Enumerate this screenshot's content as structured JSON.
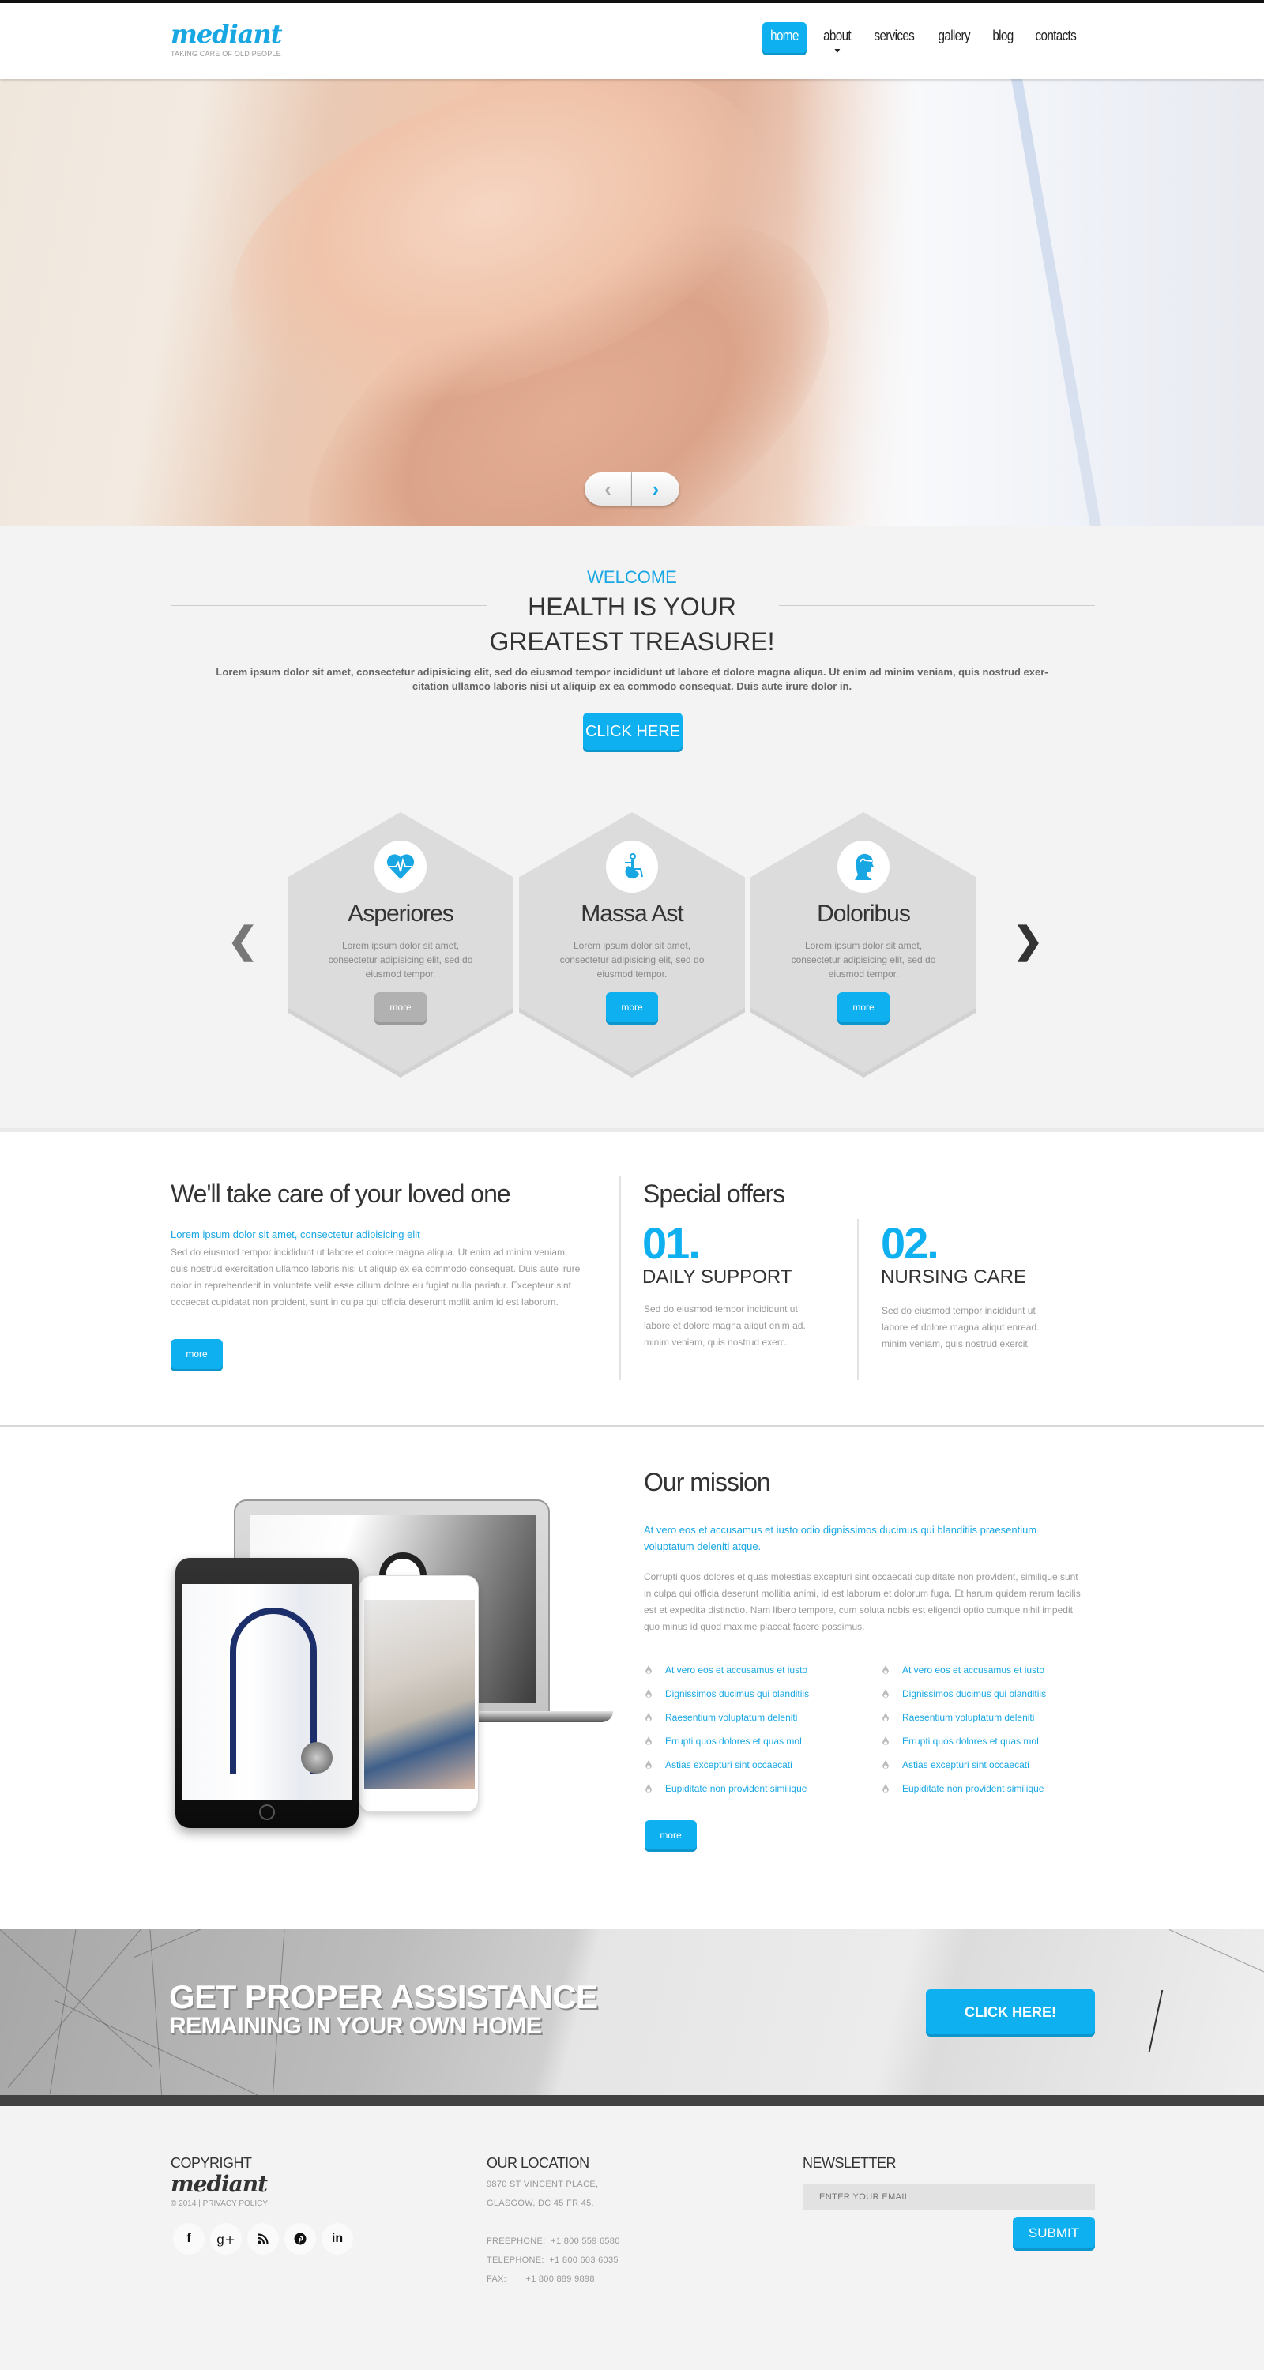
{
  "header": {
    "logo": "mediant",
    "tagline": "TAKING CARE OF OLD PEOPLE",
    "nav": [
      {
        "label": "home",
        "active": true
      },
      {
        "label": "about",
        "has_dropdown": true
      },
      {
        "label": "services"
      },
      {
        "label": "gallery"
      },
      {
        "label": "blog"
      },
      {
        "label": "contacts"
      }
    ]
  },
  "hero": {
    "image": "hands-holding-image",
    "prev_icon": "‹",
    "next_icon": "›"
  },
  "welcome": {
    "label": "WELCOME",
    "title": "HEALTH IS YOUR GREATEST TREASURE!",
    "text": "Lorem ipsum dolor sit amet, consectetur adipisicing elit, sed do eiusmod tempor incididunt ut labore et dolore magna aliqua. Ut enim ad minim veniam, quis nostrud exer- citation ullamco laboris nisi ut aliquip ex ea commodo consequat. Duis aute irure dolor in.",
    "button": "CLICK HERE",
    "carousel_prev": "❮",
    "carousel_next": "❯",
    "services": [
      {
        "icon": "heart-pulse-icon",
        "title": "Asperiores",
        "text": "Lorem ipsum dolor sit amet, consectetur adipisicing elit, sed do eiusmod tempor.",
        "button": "more",
        "button_state": "inactive"
      },
      {
        "icon": "wheelchair-icon",
        "title": "Massa Ast",
        "text": "Lorem ipsum dolor sit amet, consectetur adipisicing elit, sed do eiusmod tempor.",
        "button": "more",
        "button_state": "active"
      },
      {
        "icon": "head-profile-icon",
        "title": "Doloribus",
        "text": "Lorem ipsum dolor sit amet, consectetur adipisicing elit, sed do eiusmod tempor.",
        "button": "more",
        "button_state": "active"
      }
    ]
  },
  "care": {
    "title": "We'll take care of your loved one",
    "subtitle": "Lorem ipsum dolor sit amet, consectetur adipisicing elit",
    "text": "Sed do eiusmod tempor incididunt ut labore et dolore magna aliqua. Ut enim ad minim veniam, quis nostrud exercitation ullamco laboris nisi ut aliquip ex ea commodo consequat. Duis aute irure dolor in reprehenderit in voluptate velit esse cillum dolore eu fugiat nulla pariatur. Excepteur sint occaecat cupidatat non proident, sunt in culpa qui officia deserunt mollit anim id est laborum.",
    "button": "more"
  },
  "offers": {
    "title": "Special offers",
    "items": [
      {
        "number": "01.",
        "heading": "DAILY SUPPORT",
        "text": "Sed do eiusmod tempor incididunt ut labore et dolore magna aliqut enim ad. minim veniam, quis nostrud exerc."
      },
      {
        "number": "02.",
        "heading": "NURSING CARE",
        "text": "Sed do eiusmod tempor incididunt ut labore et dolore magna aliqut enread. minim veniam, quis nostrud exercit."
      }
    ]
  },
  "mission": {
    "title": "Our mission",
    "subtitle": "At vero eos et accusamus et iusto odio dignissimos ducimus qui blanditiis praesentium voluptatum deleniti atque.",
    "text": "Corrupti quos dolores et quas molestias excepturi sint occaecati cupiditate non provident, similique sunt in culpa qui officia deserunt mollitia animi, id est laborum et dolorum fuga. Et harum quidem rerum facilis est et expedita distinctio. Nam libero tempore, cum soluta nobis est eligendi optio cumque nihil impedit quo minus id quod maxime placeat facere possimus.",
    "list_left": [
      "At vero eos et accusamus et iusto",
      "Dignissimos ducimus qui blanditiis",
      "Raesentium voluptatum deleniti",
      "Errupti quos dolores et quas mol",
      "Astias excepturi sint occaecati",
      "Eupiditate non provident similique"
    ],
    "list_right": [
      "At vero eos et accusamus et iusto",
      "Dignissimos ducimus qui blanditiis",
      "Raesentium voluptatum deleniti",
      "Errupti quos dolores et quas mol",
      "Astias excepturi sint occaecati",
      "Eupiditate non provident similique"
    ],
    "button": "more",
    "image": "devices-medical-image"
  },
  "cta": {
    "title": "GET PROPER ASSISTANCE",
    "subtitle": "REMAINING IN YOUR OWN HOME",
    "button": "CLICK HERE!"
  },
  "footer": {
    "copyright": {
      "heading": "COPYRIGHT",
      "logo": "mediant",
      "copy": "© 2014",
      "separator": "|",
      "privacy": "PRIVACY POLICY",
      "social": [
        {
          "name": "facebook",
          "glyph": "f"
        },
        {
          "name": "google-plus",
          "glyph": "g+"
        },
        {
          "name": "rss",
          "glyph": "◝"
        },
        {
          "name": "pinterest",
          "glyph": "℗"
        },
        {
          "name": "linkedin",
          "glyph": "in"
        }
      ]
    },
    "location": {
      "heading": "OUR LOCATION",
      "address_line1": "9870 ST VINCENT PLACE,",
      "address_line2": "GLASGOW, DC 45 FR 45.",
      "freephone_label": "FREEPHONE:",
      "freephone": "+1 800 559 6580",
      "telephone_label": "TELEPHONE:",
      "telephone": "+1 800 603 6035",
      "fax_label": "FAX:",
      "fax": "+1 800 889 9898"
    },
    "newsletter": {
      "heading": "NEWSLETTER",
      "placeholder": "ENTER YOUR EMAIL",
      "button": "SUBMIT"
    }
  },
  "colors": {
    "accent": "#0fb0f0",
    "accent_dark": "#0d96cc",
    "text_dark": "#333333",
    "text_muted": "#999999",
    "footer_bar": "#424242"
  }
}
